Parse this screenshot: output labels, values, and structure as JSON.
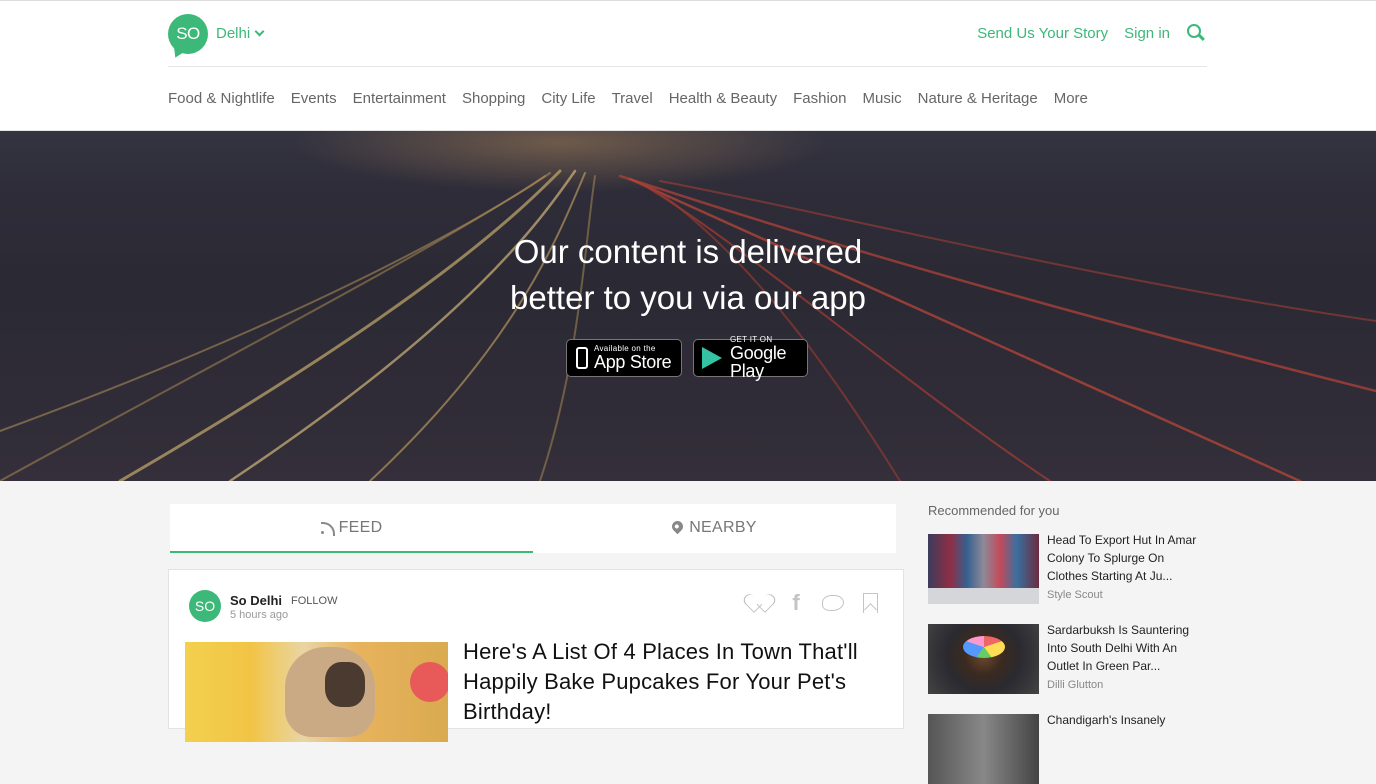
{
  "header": {
    "logo_text": "SO",
    "city": "Delhi",
    "links": {
      "send_story": "Send Us Your Story",
      "sign_in": "Sign in"
    },
    "nav": [
      "Food & Nightlife",
      "Events",
      "Entertainment",
      "Shopping",
      "City Life",
      "Travel",
      "Health & Beauty",
      "Fashion",
      "Music",
      "Nature & Heritage",
      "More"
    ]
  },
  "hero": {
    "line1": "Our content is delivered",
    "line2": "better to you via our app",
    "appstore": {
      "small": "Available on the",
      "big": "App Store"
    },
    "googleplay": {
      "small": "GET IT ON",
      "big": "Google Play"
    }
  },
  "tabs": [
    {
      "label": "FEED",
      "icon": "rss-icon",
      "active": true
    },
    {
      "label": "NEARBY",
      "icon": "location-pin-icon",
      "active": false
    }
  ],
  "feed": {
    "card": {
      "avatar": "SO",
      "author": "So Delhi",
      "follow": "FOLLOW",
      "time": "5 hours ago",
      "title": "Here's A List Of 4 Places In Town That'll Happily Bake Pupcakes For Your Pet's Birthday!"
    }
  },
  "sidebar": {
    "heading": "Recommended for you",
    "items": [
      {
        "title": "Head To Export Hut In Amar Colony To Splurge On Clothes Starting At Ju...",
        "source": "Style Scout"
      },
      {
        "title": "Sardarbuksh Is Sauntering Into South Delhi With An Outlet In Green Par...",
        "source": "Dilli Glutton"
      },
      {
        "title": "Chandigarh's Insanely",
        "source": ""
      }
    ]
  },
  "colors": {
    "brand": "#3cb878"
  }
}
